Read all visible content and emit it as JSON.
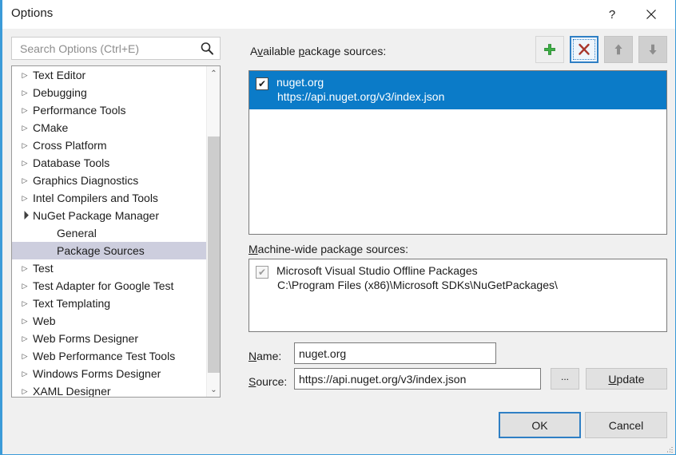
{
  "window": {
    "title": "Options",
    "help_label": "?",
    "close_label": "✕"
  },
  "search": {
    "placeholder": "Search Options (Ctrl+E)",
    "value": "",
    "icon": "search-icon"
  },
  "tree": {
    "items": [
      {
        "label": "Text Editor",
        "level": 0,
        "expandable": true,
        "expanded": false,
        "selected": false
      },
      {
        "label": "Debugging",
        "level": 0,
        "expandable": true,
        "expanded": false,
        "selected": false
      },
      {
        "label": "Performance Tools",
        "level": 0,
        "expandable": true,
        "expanded": false,
        "selected": false
      },
      {
        "label": "CMake",
        "level": 0,
        "expandable": true,
        "expanded": false,
        "selected": false
      },
      {
        "label": "Cross Platform",
        "level": 0,
        "expandable": true,
        "expanded": false,
        "selected": false
      },
      {
        "label": "Database Tools",
        "level": 0,
        "expandable": true,
        "expanded": false,
        "selected": false
      },
      {
        "label": "Graphics Diagnostics",
        "level": 0,
        "expandable": true,
        "expanded": false,
        "selected": false
      },
      {
        "label": "Intel Compilers and Tools",
        "level": 0,
        "expandable": true,
        "expanded": false,
        "selected": false
      },
      {
        "label": "NuGet Package Manager",
        "level": 0,
        "expandable": true,
        "expanded": true,
        "selected": false
      },
      {
        "label": "General",
        "level": 1,
        "expandable": false,
        "expanded": false,
        "selected": false
      },
      {
        "label": "Package Sources",
        "level": 1,
        "expandable": false,
        "expanded": false,
        "selected": true
      },
      {
        "label": "Test",
        "level": 0,
        "expandable": true,
        "expanded": false,
        "selected": false
      },
      {
        "label": "Test Adapter for Google Test",
        "level": 0,
        "expandable": true,
        "expanded": false,
        "selected": false
      },
      {
        "label": "Text Templating",
        "level": 0,
        "expandable": true,
        "expanded": false,
        "selected": false
      },
      {
        "label": "Web",
        "level": 0,
        "expandable": true,
        "expanded": false,
        "selected": false
      },
      {
        "label": "Web Forms Designer",
        "level": 0,
        "expandable": true,
        "expanded": false,
        "selected": false
      },
      {
        "label": "Web Performance Test Tools",
        "level": 0,
        "expandable": true,
        "expanded": false,
        "selected": false
      },
      {
        "label": "Windows Forms Designer",
        "level": 0,
        "expandable": true,
        "expanded": false,
        "selected": false
      },
      {
        "label": "XAML Designer",
        "level": 0,
        "expandable": true,
        "expanded": false,
        "selected": false
      }
    ],
    "collapsed_glyph": "▷",
    "expanded_glyph": "◢",
    "scroll_up_glyph": "⌃",
    "scroll_down_glyph": "⌄"
  },
  "available": {
    "label_pre": "A",
    "label_key": "v",
    "label_post": "ailable ",
    "label_key2": "p",
    "label_post2": "ackage sources:",
    "label_full": "Available package sources:",
    "sources": [
      {
        "name": "nuget.org",
        "url": "https://api.nuget.org/v3/index.json",
        "checked": true,
        "selected": true
      }
    ],
    "check_glyph": "✔"
  },
  "toolbar": {
    "add_label": "+",
    "add_name": "plus-icon",
    "remove_label": "✕",
    "remove_name": "x-icon",
    "up_label": "↑",
    "up_name": "arrow-up-icon",
    "down_label": "↓",
    "down_name": "arrow-down-icon"
  },
  "machine_wide": {
    "label_key": "M",
    "label_rest": "achine-wide package sources:",
    "label_full": "Machine-wide package sources:",
    "sources": [
      {
        "name": "Microsoft Visual Studio Offline Packages",
        "path": "C:\\Program Files (x86)\\Microsoft SDKs\\NuGetPackages\\",
        "checked": true
      }
    ],
    "check_glyph": "✔"
  },
  "form": {
    "name_label_key": "N",
    "name_label_rest": "ame:",
    "name_label_full": "Name:",
    "name_value": "nuget.org",
    "source_label_key": "S",
    "source_label_rest": "ource:",
    "source_label_full": "Source:",
    "source_value": "https://api.nuget.org/v3/index.json",
    "browse_label": "...",
    "update_label_key": "U",
    "update_label_rest": "pdate",
    "update_label_full": "Update"
  },
  "footer": {
    "ok_label": "OK",
    "cancel_label": "Cancel"
  },
  "colors": {
    "accent_border": "#3b9bd8",
    "selection_blue": "#0b7bc8",
    "tree_selection": "#cdcede",
    "add_green": "#3faf46",
    "remove_red": "#a8362c",
    "dialog_bg": "#f0f0f0"
  }
}
